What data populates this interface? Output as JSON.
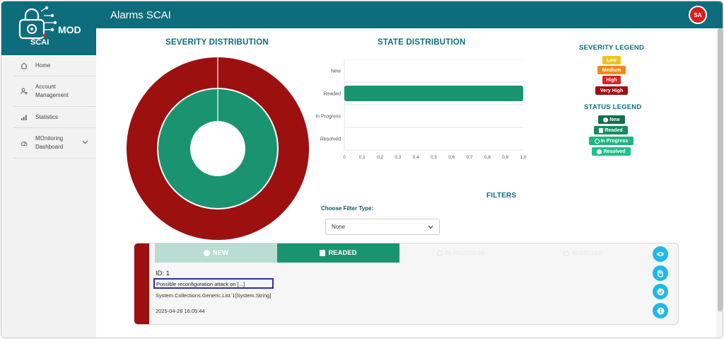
{
  "app": {
    "title": "Alarms SCAI",
    "avatar_initials": "SA",
    "logo_text_1": "MOD",
    "logo_text_2": "SCAI"
  },
  "sidebar": {
    "items": [
      {
        "label": "Home",
        "icon": "home-icon"
      },
      {
        "label": "Account Management",
        "icon": "user-gear-icon"
      },
      {
        "label": "Statistics",
        "icon": "bar-chart-icon"
      },
      {
        "label": "MOnitoring Dashboard",
        "icon": "dashboard-gauge-icon"
      }
    ]
  },
  "severity_distribution": {
    "title": "SEVERITY DISTRIBUTION"
  },
  "state_distribution": {
    "title": "STATE DISTRIBUTION"
  },
  "chart_data": [
    {
      "type": "pie",
      "title": "SEVERITY DISTRIBUTION",
      "rings": [
        {
          "name": "severity",
          "slices": [
            {
              "label": "Very High",
              "value": 1,
              "color": "#9c1010"
            }
          ]
        },
        {
          "name": "status",
          "slices": [
            {
              "label": "Readed",
              "value": 1,
              "color": "#1a9470"
            }
          ]
        }
      ]
    },
    {
      "type": "bar",
      "title": "STATE DISTRIBUTION",
      "orientation": "horizontal",
      "categories": [
        "New",
        "Readed",
        "In Progress",
        "Resolved"
      ],
      "values": [
        0,
        1,
        0,
        0
      ],
      "xlim": [
        0,
        1
      ],
      "xticks": [
        "0",
        "0,1",
        "0,2",
        "0,3",
        "0,4",
        "0,5",
        "0,6",
        "0,7",
        "0,8",
        "0,9",
        "1,0"
      ],
      "color": "#1a9470",
      "grid": true
    }
  ],
  "severity_legend": {
    "title": "SEVERITY LEGEND",
    "items": [
      {
        "label": "Low",
        "color": "#f0c419"
      },
      {
        "label": "Medium",
        "color": "#f08a1c"
      },
      {
        "label": "High",
        "color": "#e02020"
      },
      {
        "label": "Very High",
        "color": "#9c1010"
      }
    ]
  },
  "status_legend": {
    "title": "STATUS LEGEND",
    "items": [
      {
        "label": "New",
        "color": "#0f6e4f",
        "icon": "info-icon"
      },
      {
        "label": "Readed",
        "color": "#168a63",
        "icon": "book-icon"
      },
      {
        "label": "In Progress",
        "color": "#22b483",
        "icon": "sync-icon"
      },
      {
        "label": "Resolved",
        "color": "#1fc28a",
        "icon": "check-circle-icon"
      }
    ]
  },
  "filters": {
    "title": "FILTERS",
    "type_label": "Choose Filter Type:",
    "selected": "None"
  },
  "alarm_card": {
    "tabs": [
      {
        "label": "NEW",
        "state": "past"
      },
      {
        "label": "READED",
        "state": "active"
      },
      {
        "label": "IN PROGRESS",
        "state": "pending"
      },
      {
        "label": "RESOLVED",
        "state": "pending"
      }
    ],
    "id_text": "ID: 1",
    "message": "Possible reconfiguration attack on [...]",
    "detail": "System.Collections.Generic.List`1[System.String]",
    "timestamp": "2025-04-28 16:05:44",
    "actions": [
      "eye-icon",
      "hand-icon",
      "check-badge-icon",
      "info-icon"
    ]
  }
}
